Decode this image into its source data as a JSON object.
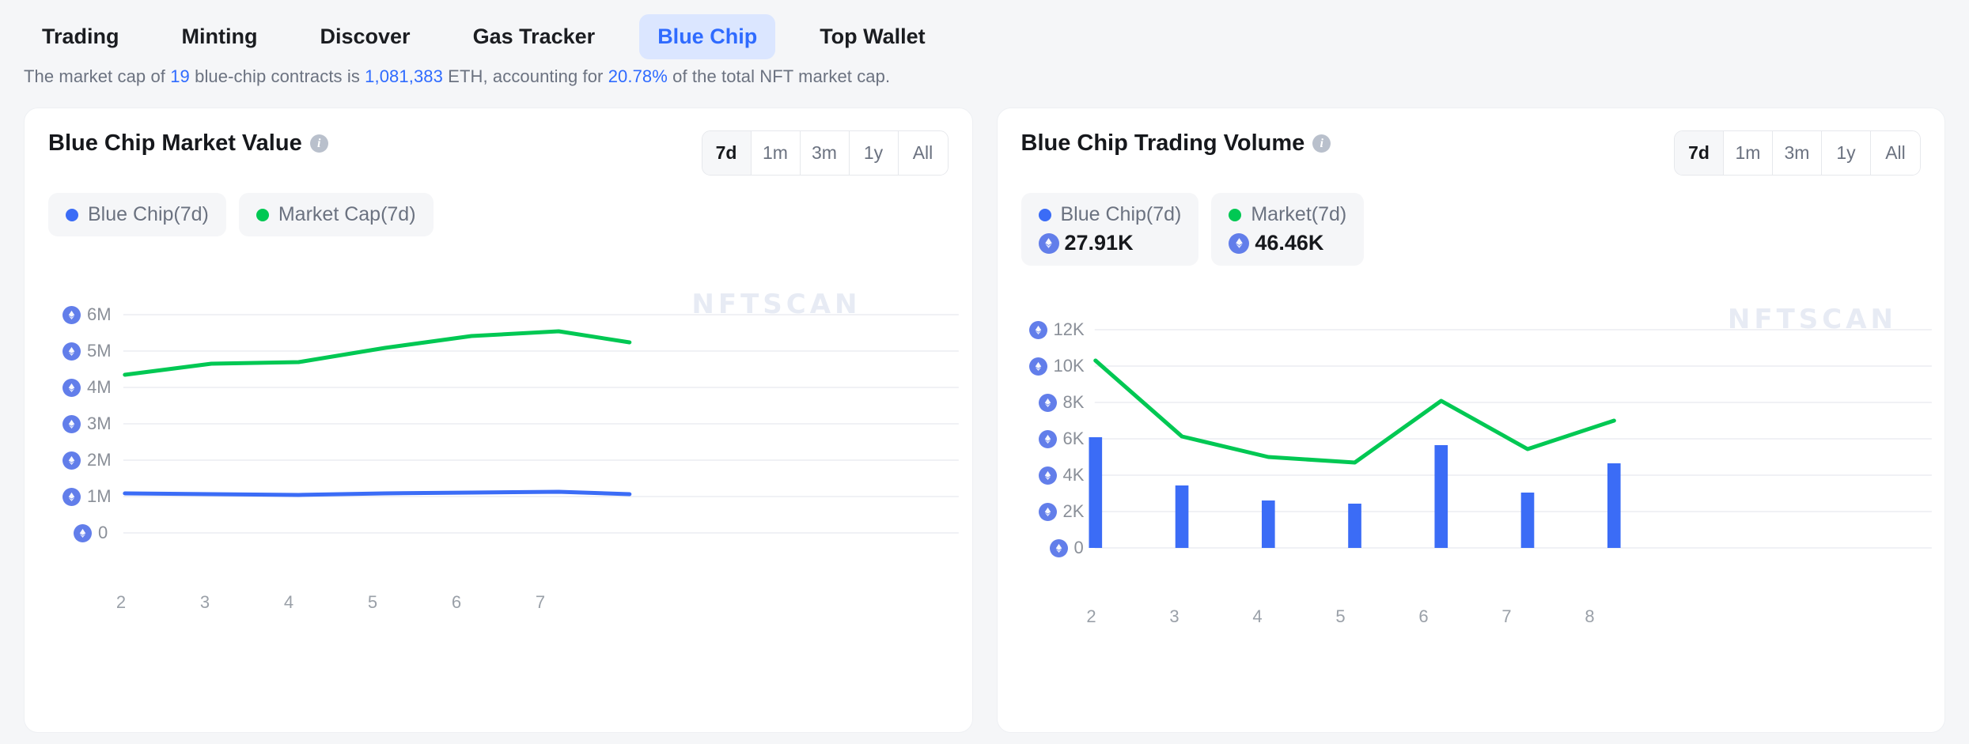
{
  "nav": {
    "items": [
      {
        "label": "Trading",
        "active": false
      },
      {
        "label": "Minting",
        "active": false
      },
      {
        "label": "Discover",
        "active": false
      },
      {
        "label": "Gas Tracker",
        "active": false
      },
      {
        "label": "Blue Chip",
        "active": true
      },
      {
        "label": "Top Wallet",
        "active": false
      }
    ]
  },
  "subtitle": {
    "part1": "The market cap of ",
    "count": "19",
    "part2": " blue-chip contracts is ",
    "marketcap": "1,081,383",
    "part3": " ETH, accounting for ",
    "percent": "20.78%",
    "part4": " of the total NFT market cap."
  },
  "colors": {
    "blue": "#3b6cf6",
    "green": "#00c853",
    "accent": "#2f6bff",
    "grid": "#f0f1f5",
    "watermark": "#e7ebf4",
    "eth_badge": "#627eea"
  },
  "watermark": "NFTSCAN",
  "left_card": {
    "title": "Blue Chip Market Value",
    "info_icon": "info-icon",
    "ranges": [
      {
        "label": "7d",
        "active": true
      },
      {
        "label": "1m",
        "active": false
      },
      {
        "label": "3m",
        "active": false
      },
      {
        "label": "1y",
        "active": false
      },
      {
        "label": "All",
        "active": false
      }
    ],
    "legend": [
      {
        "label": "Blue Chip(7d)",
        "color": "blue",
        "value": null
      },
      {
        "label": "Market Cap(7d)",
        "color": "green",
        "value": null
      }
    ]
  },
  "right_card": {
    "title": "Blue Chip Trading Volume",
    "info_icon": "info-icon",
    "ranges": [
      {
        "label": "7d",
        "active": true
      },
      {
        "label": "1m",
        "active": false
      },
      {
        "label": "3m",
        "active": false
      },
      {
        "label": "1y",
        "active": false
      },
      {
        "label": "All",
        "active": false
      }
    ],
    "legend": [
      {
        "label": "Blue Chip(7d)",
        "color": "blue",
        "value": "27.91K"
      },
      {
        "label": "Market(7d)",
        "color": "green",
        "value": "46.46K"
      }
    ]
  },
  "chart_data": [
    {
      "type": "line",
      "title": "Blue Chip Market Value",
      "xlabel": "",
      "ylabel": "ETH",
      "x": [
        "2",
        "3",
        "4",
        "5",
        "6",
        "7"
      ],
      "ylim": [
        0,
        6000000
      ],
      "yticks": [
        0,
        1000000,
        2000000,
        3000000,
        4000000,
        5000000,
        6000000
      ],
      "ytick_labels": [
        "0",
        "1M",
        "2M",
        "3M",
        "4M",
        "5M",
        "6M"
      ],
      "grid": true,
      "legend_position": "top-left",
      "series": [
        {
          "name": "Blue Chip(7d)",
          "color": "#3b6cf6",
          "values": [
            1085000,
            1080000,
            1075000,
            1090000,
            1100000,
            1075000
          ],
          "extra_point": 1070000
        },
        {
          "name": "Market Cap(7d)",
          "color": "#00c853",
          "values": [
            4350000,
            4650000,
            4680000,
            5080000,
            5400000,
            5520000
          ],
          "extra_point": 5200000
        }
      ]
    },
    {
      "type": "bar",
      "title": "Blue Chip Trading Volume",
      "xlabel": "",
      "ylabel": "ETH",
      "categories": [
        "2",
        "3",
        "4",
        "5",
        "6",
        "7",
        "8"
      ],
      "ylim": [
        0,
        12000
      ],
      "yticks": [
        0,
        2000,
        4000,
        6000,
        8000,
        10000,
        12000
      ],
      "ytick_labels": [
        "0",
        "2K",
        "4K",
        "6K",
        "8K",
        "10K",
        "12K"
      ],
      "grid": true,
      "legend_position": "top-left",
      "series": [
        {
          "name": "Blue Chip(7d)",
          "type": "bar",
          "color": "#3b6cf6",
          "values": [
            6100,
            3450,
            2600,
            2450,
            5650,
            3050,
            4650
          ]
        },
        {
          "name": "Market(7d)",
          "type": "line",
          "color": "#00c853",
          "values": [
            10300,
            6150,
            5000,
            4700,
            8100,
            5450,
            7000
          ]
        }
      ]
    }
  ]
}
